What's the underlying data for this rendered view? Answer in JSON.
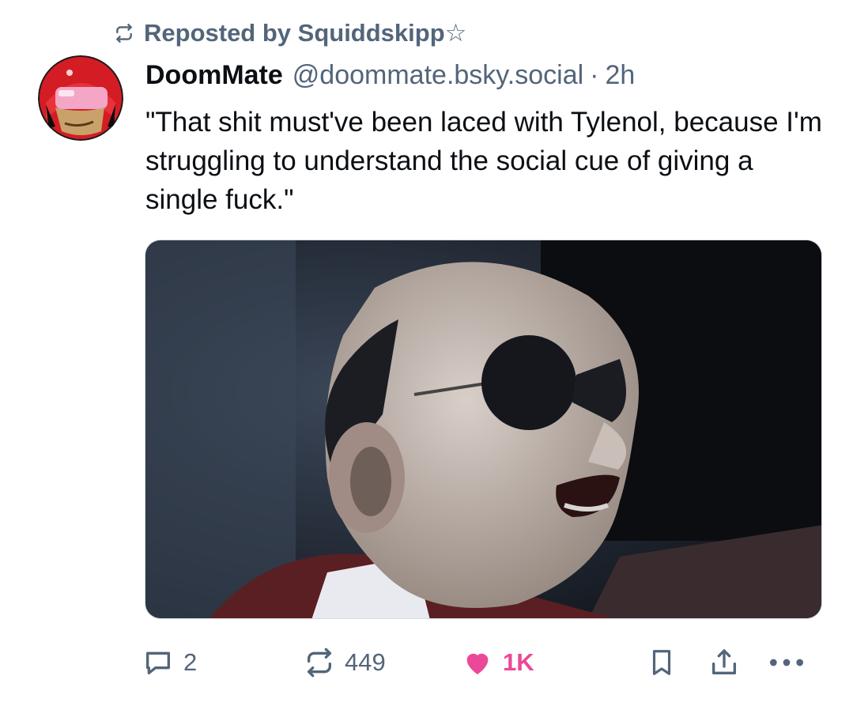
{
  "repost": {
    "label": "Reposted by Squiddskipp☆",
    "icon": "repost-icon"
  },
  "post": {
    "author": {
      "display_name": "DoomMate",
      "handle": "@doommate.bsky.social",
      "avatar": "avatar-cartoon-red-helmet"
    },
    "separator": "·",
    "time": "2h",
    "text": "\"That shit must've been laced with Tylenol, because I'm struggling to understand the social cue of giving a single fuck.\"",
    "media": {
      "type": "image",
      "description_icon": "photo-man-sunglasses"
    }
  },
  "actions": {
    "reply": {
      "icon": "reply-icon",
      "count": "2"
    },
    "repost": {
      "icon": "repost-icon",
      "count": "449"
    },
    "like": {
      "icon": "heart-icon",
      "count": "1K",
      "active": true
    },
    "bookmark": {
      "icon": "bookmark-icon"
    },
    "share": {
      "icon": "share-icon"
    },
    "more": {
      "icon": "more-icon"
    }
  },
  "colors": {
    "muted": "#53657a",
    "like": "#ec4899",
    "text": "#0b0f14"
  }
}
